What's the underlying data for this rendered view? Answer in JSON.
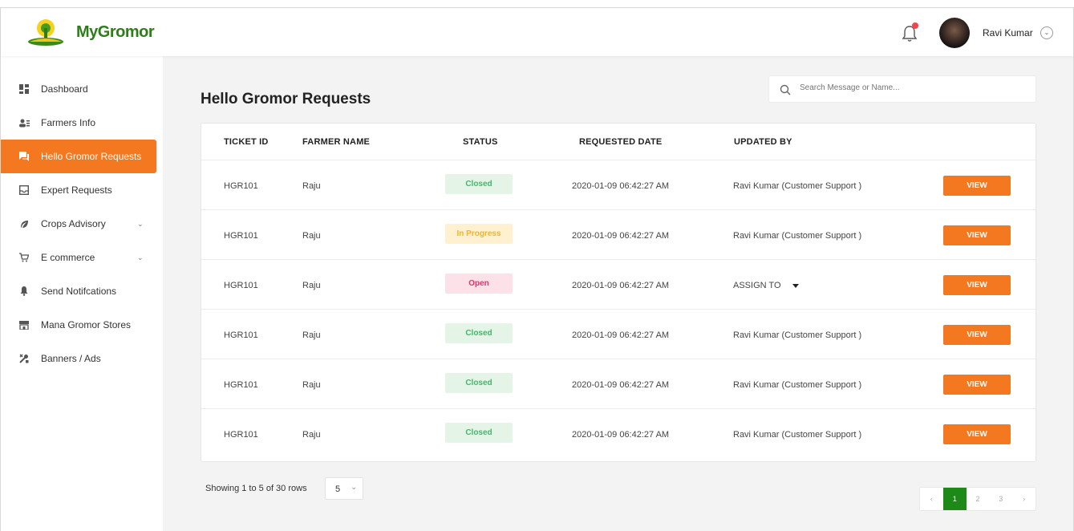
{
  "brand": {
    "name": "MyGromor"
  },
  "user": {
    "name": "Ravi Kumar"
  },
  "sidebar": {
    "items": [
      {
        "label": "Dashboard"
      },
      {
        "label": "Farmers Info"
      },
      {
        "label": "Hello Gromor Requests"
      },
      {
        "label": "Expert Requests"
      },
      {
        "label": "Crops Advisory"
      },
      {
        "label": "E commerce"
      },
      {
        "label": "Send Notifcations"
      },
      {
        "label": "Mana Gromor Stores"
      },
      {
        "label": "Banners  / Ads"
      }
    ]
  },
  "page": {
    "title": "Hello Gromor Requests"
  },
  "search": {
    "placeholder": "Search Message or Name..."
  },
  "table": {
    "columns": [
      "TICKET ID",
      "FARMER NAME",
      "STATUS",
      "REQUESTED DATE",
      "UPDATED BY"
    ],
    "view_label": "VIEW",
    "assign_label": "ASSIGN TO",
    "rows": [
      {
        "ticket": "HGR101",
        "farmer": "Raju",
        "status": "Closed",
        "date": "2020-01-09 06:42:27 AM",
        "updated_by": "Ravi Kumar (Customer Support )"
      },
      {
        "ticket": "HGR101",
        "farmer": "Raju",
        "status": "In Progress",
        "date": "2020-01-09 06:42:27 AM",
        "updated_by": "Ravi Kumar (Customer Support )"
      },
      {
        "ticket": "HGR101",
        "farmer": "Raju",
        "status": "Open",
        "date": "2020-01-09 06:42:27 AM",
        "updated_by": "ASSIGN TO"
      },
      {
        "ticket": "HGR101",
        "farmer": "Raju",
        "status": "Closed",
        "date": "2020-01-09 06:42:27 AM",
        "updated_by": "Ravi Kumar (Customer Support )"
      },
      {
        "ticket": "HGR101",
        "farmer": "Raju",
        "status": "Closed",
        "date": "2020-01-09 06:42:27 AM",
        "updated_by": "Ravi Kumar (Customer Support )"
      },
      {
        "ticket": "HGR101",
        "farmer": "Raju",
        "status": "Closed",
        "date": "2020-01-09 06:42:27 AM",
        "updated_by": "Ravi Kumar (Customer Support )"
      }
    ]
  },
  "footer": {
    "showing": "Showing 1 to 5 of 30 rows",
    "page_size": "5",
    "pages": [
      "1",
      "2",
      "3"
    ],
    "prev": "‹",
    "next": "›"
  },
  "colors": {
    "accent": "#f47820",
    "brand_green": "#2f7d1a",
    "page_active": "#1d8a17"
  }
}
